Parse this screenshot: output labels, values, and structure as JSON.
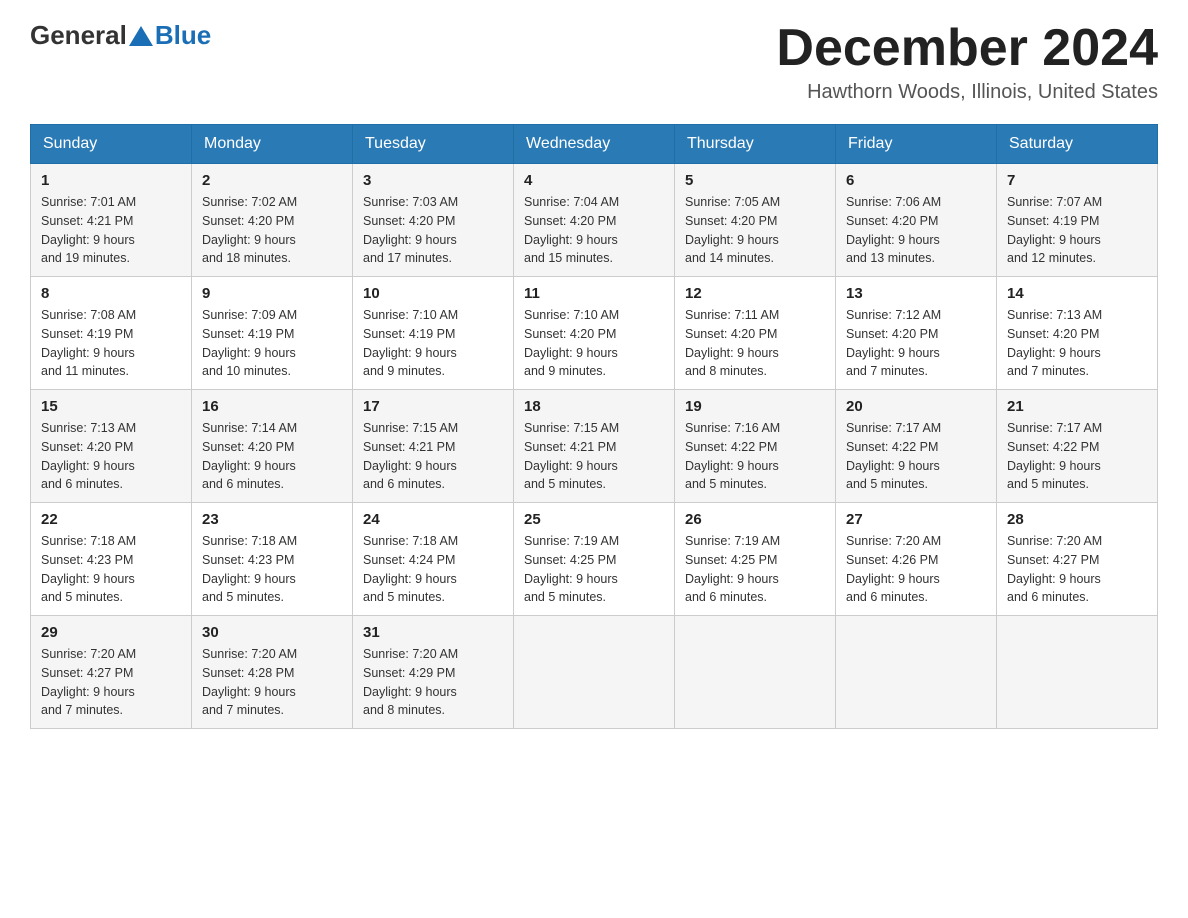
{
  "header": {
    "logo_general": "General",
    "logo_blue": "Blue",
    "month_title": "December 2024",
    "location": "Hawthorn Woods, Illinois, United States"
  },
  "days_of_week": [
    "Sunday",
    "Monday",
    "Tuesday",
    "Wednesday",
    "Thursday",
    "Friday",
    "Saturday"
  ],
  "weeks": [
    [
      {
        "date": "1",
        "sunrise": "7:01 AM",
        "sunset": "4:21 PM",
        "daylight": "9 hours and 19 minutes."
      },
      {
        "date": "2",
        "sunrise": "7:02 AM",
        "sunset": "4:20 PM",
        "daylight": "9 hours and 18 minutes."
      },
      {
        "date": "3",
        "sunrise": "7:03 AM",
        "sunset": "4:20 PM",
        "daylight": "9 hours and 17 minutes."
      },
      {
        "date": "4",
        "sunrise": "7:04 AM",
        "sunset": "4:20 PM",
        "daylight": "9 hours and 15 minutes."
      },
      {
        "date": "5",
        "sunrise": "7:05 AM",
        "sunset": "4:20 PM",
        "daylight": "9 hours and 14 minutes."
      },
      {
        "date": "6",
        "sunrise": "7:06 AM",
        "sunset": "4:20 PM",
        "daylight": "9 hours and 13 minutes."
      },
      {
        "date": "7",
        "sunrise": "7:07 AM",
        "sunset": "4:19 PM",
        "daylight": "9 hours and 12 minutes."
      }
    ],
    [
      {
        "date": "8",
        "sunrise": "7:08 AM",
        "sunset": "4:19 PM",
        "daylight": "9 hours and 11 minutes."
      },
      {
        "date": "9",
        "sunrise": "7:09 AM",
        "sunset": "4:19 PM",
        "daylight": "9 hours and 10 minutes."
      },
      {
        "date": "10",
        "sunrise": "7:10 AM",
        "sunset": "4:19 PM",
        "daylight": "9 hours and 9 minutes."
      },
      {
        "date": "11",
        "sunrise": "7:10 AM",
        "sunset": "4:20 PM",
        "daylight": "9 hours and 9 minutes."
      },
      {
        "date": "12",
        "sunrise": "7:11 AM",
        "sunset": "4:20 PM",
        "daylight": "9 hours and 8 minutes."
      },
      {
        "date": "13",
        "sunrise": "7:12 AM",
        "sunset": "4:20 PM",
        "daylight": "9 hours and 7 minutes."
      },
      {
        "date": "14",
        "sunrise": "7:13 AM",
        "sunset": "4:20 PM",
        "daylight": "9 hours and 7 minutes."
      }
    ],
    [
      {
        "date": "15",
        "sunrise": "7:13 AM",
        "sunset": "4:20 PM",
        "daylight": "9 hours and 6 minutes."
      },
      {
        "date": "16",
        "sunrise": "7:14 AM",
        "sunset": "4:20 PM",
        "daylight": "9 hours and 6 minutes."
      },
      {
        "date": "17",
        "sunrise": "7:15 AM",
        "sunset": "4:21 PM",
        "daylight": "9 hours and 6 minutes."
      },
      {
        "date": "18",
        "sunrise": "7:15 AM",
        "sunset": "4:21 PM",
        "daylight": "9 hours and 5 minutes."
      },
      {
        "date": "19",
        "sunrise": "7:16 AM",
        "sunset": "4:22 PM",
        "daylight": "9 hours and 5 minutes."
      },
      {
        "date": "20",
        "sunrise": "7:17 AM",
        "sunset": "4:22 PM",
        "daylight": "9 hours and 5 minutes."
      },
      {
        "date": "21",
        "sunrise": "7:17 AM",
        "sunset": "4:22 PM",
        "daylight": "9 hours and 5 minutes."
      }
    ],
    [
      {
        "date": "22",
        "sunrise": "7:18 AM",
        "sunset": "4:23 PM",
        "daylight": "9 hours and 5 minutes."
      },
      {
        "date": "23",
        "sunrise": "7:18 AM",
        "sunset": "4:23 PM",
        "daylight": "9 hours and 5 minutes."
      },
      {
        "date": "24",
        "sunrise": "7:18 AM",
        "sunset": "4:24 PM",
        "daylight": "9 hours and 5 minutes."
      },
      {
        "date": "25",
        "sunrise": "7:19 AM",
        "sunset": "4:25 PM",
        "daylight": "9 hours and 5 minutes."
      },
      {
        "date": "26",
        "sunrise": "7:19 AM",
        "sunset": "4:25 PM",
        "daylight": "9 hours and 6 minutes."
      },
      {
        "date": "27",
        "sunrise": "7:20 AM",
        "sunset": "4:26 PM",
        "daylight": "9 hours and 6 minutes."
      },
      {
        "date": "28",
        "sunrise": "7:20 AM",
        "sunset": "4:27 PM",
        "daylight": "9 hours and 6 minutes."
      }
    ],
    [
      {
        "date": "29",
        "sunrise": "7:20 AM",
        "sunset": "4:27 PM",
        "daylight": "9 hours and 7 minutes."
      },
      {
        "date": "30",
        "sunrise": "7:20 AM",
        "sunset": "4:28 PM",
        "daylight": "9 hours and 7 minutes."
      },
      {
        "date": "31",
        "sunrise": "7:20 AM",
        "sunset": "4:29 PM",
        "daylight": "9 hours and 8 minutes."
      },
      null,
      null,
      null,
      null
    ]
  ],
  "labels": {
    "sunrise": "Sunrise:",
    "sunset": "Sunset:",
    "daylight": "Daylight:"
  }
}
